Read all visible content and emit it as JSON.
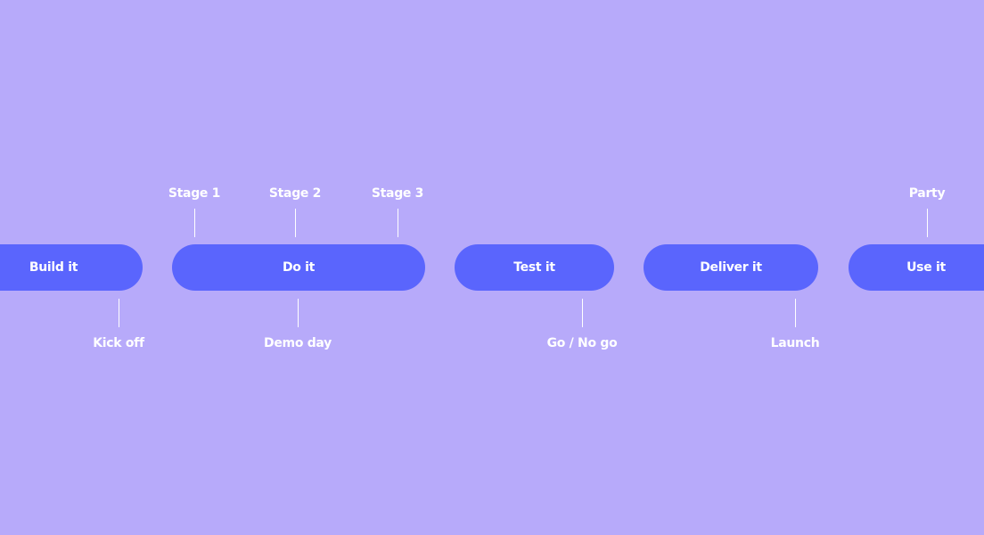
{
  "phases": [
    {
      "label": "Build it"
    },
    {
      "label": "Do it"
    },
    {
      "label": "Test it"
    },
    {
      "label": "Deliver it"
    },
    {
      "label": "Use it"
    }
  ],
  "milestones_top": [
    {
      "label": "Stage 1"
    },
    {
      "label": "Stage 2"
    },
    {
      "label": "Stage  3"
    },
    {
      "label": "Party"
    }
  ],
  "milestones_bottom": [
    {
      "label": "Kick off"
    },
    {
      "label": "Demo day"
    },
    {
      "label": "Go / No go"
    },
    {
      "label": "Launch"
    }
  ],
  "colors": {
    "background": "#b7aafa",
    "pill": "#5a65fd",
    "text": "#ffffff"
  }
}
